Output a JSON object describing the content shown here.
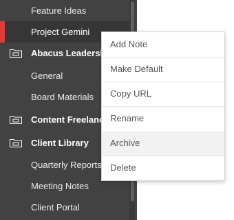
{
  "sidebar": {
    "items": [
      {
        "label": "Feature Ideas",
        "kind": "child",
        "selected": false
      },
      {
        "label": "Project Gemini",
        "kind": "child",
        "selected": true
      },
      {
        "label": "Abacus Leadership",
        "kind": "group",
        "icon": "folder-icon"
      },
      {
        "label": "General",
        "kind": "child"
      },
      {
        "label": "Board Materials",
        "kind": "child"
      },
      {
        "label": "Content Freelancers",
        "kind": "group",
        "icon": "folder-icon"
      },
      {
        "label": "Client Library",
        "kind": "group",
        "icon": "folder-icon"
      },
      {
        "label": "Quarterly Reports",
        "kind": "child"
      },
      {
        "label": "Meeting Notes",
        "kind": "child"
      },
      {
        "label": "Client Portal",
        "kind": "child"
      }
    ],
    "accent_color": "#e23a3a",
    "background_color": "#424242"
  },
  "context_menu": {
    "items": [
      {
        "label": "Add Note"
      },
      {
        "label": "Make Default"
      },
      {
        "label": "Copy URL"
      },
      {
        "label": "Rename"
      },
      {
        "label": "Archive",
        "hovered": true
      },
      {
        "label": "Delete"
      }
    ]
  }
}
